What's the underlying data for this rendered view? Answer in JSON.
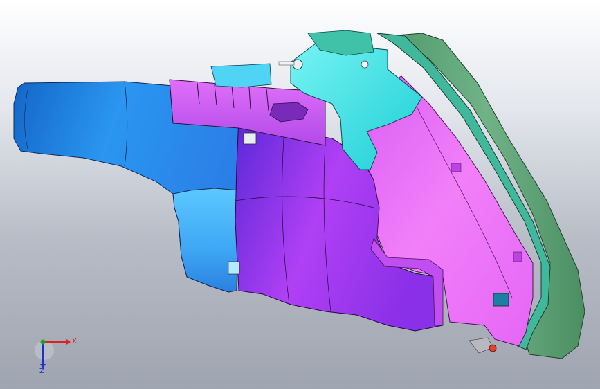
{
  "viewport": {
    "background_top": "#ffffff",
    "background_bottom": "#9fa5b0"
  },
  "model": {
    "colors": {
      "blue_part": "#1a7fe0",
      "blue_light": "#6fd4ff",
      "purple_part": "#a03cf0",
      "magenta_part": "#f07cf8",
      "cyan_part": "#28e0e0",
      "green_lens": "#5da878",
      "teal_frame": "#3db89a",
      "edge_line": "#1a1a2a"
    }
  },
  "triad": {
    "x_label": "X",
    "y_label": "Z",
    "x_color": "#e02020",
    "y_color": "#2030d0",
    "z_color": "#20a020"
  }
}
